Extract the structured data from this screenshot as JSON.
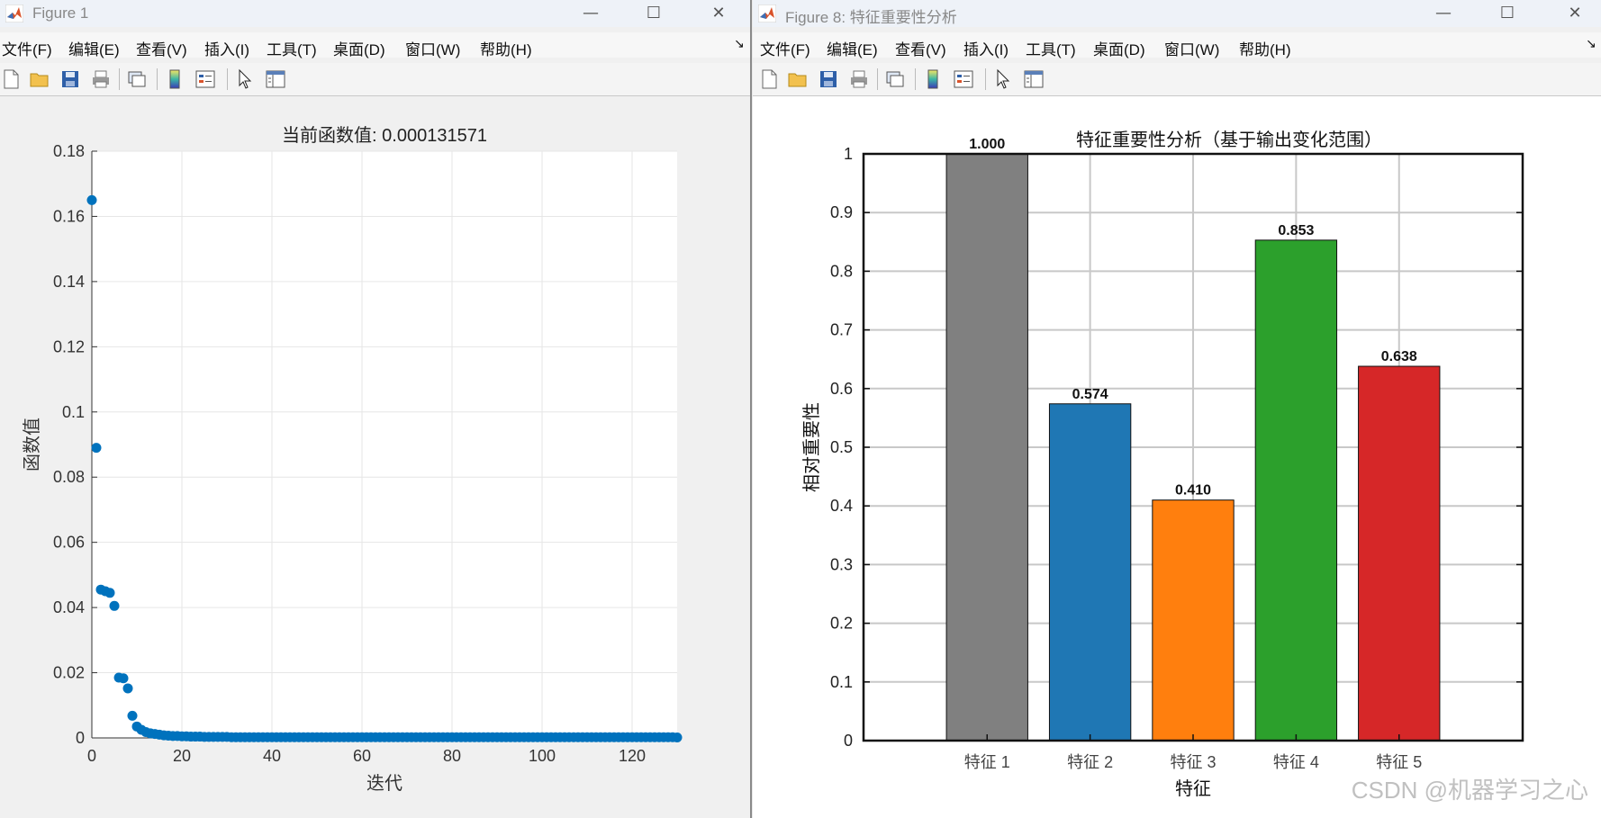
{
  "window1": {
    "title": "Figure 1",
    "controls": {
      "minimize": "—",
      "maximize": "☐",
      "close": "✕"
    },
    "menu": [
      "文件(F)",
      "编辑(E)",
      "查看(V)",
      "插入(I)",
      "工具(T)",
      "桌面(D)",
      "窗口(W)",
      "帮助(H)"
    ],
    "menu_overflow": "↘",
    "toolbar": [
      "new-file-icon",
      "open-folder-icon",
      "save-icon",
      "print-icon",
      "link-icon",
      "colorbar-icon",
      "legend-icon",
      "pointer-icon",
      "property-inspector-icon"
    ],
    "chart_data": {
      "type": "scatter",
      "title": "当前函数值: 0.000131571",
      "xlabel": "迭代",
      "ylabel": "函数值",
      "xlim": [
        0,
        130
      ],
      "ylim": [
        0,
        0.18
      ],
      "xticks": [
        "0",
        "20",
        "40",
        "60",
        "80",
        "100",
        "120"
      ],
      "yticks": [
        "0",
        "0.02",
        "0.04",
        "0.06",
        "0.08",
        "0.1",
        "0.12",
        "0.14",
        "0.16",
        "0.18"
      ],
      "grid": true,
      "point_color": "#0072bd",
      "x": [
        0,
        1,
        2,
        3,
        4,
        5,
        6,
        7,
        8,
        9,
        10,
        11,
        12,
        13,
        14,
        15,
        16,
        17,
        18,
        19,
        20,
        21,
        22,
        23,
        24,
        25,
        26,
        27,
        28,
        29,
        30,
        31,
        32,
        33,
        34,
        35,
        36,
        37,
        38,
        39,
        40,
        41,
        42,
        43,
        44,
        45,
        46,
        47,
        48,
        49,
        50,
        51,
        52,
        53,
        54,
        55,
        56,
        57,
        58,
        59,
        60,
        61,
        62,
        63,
        64,
        65,
        66,
        67,
        68,
        69,
        70,
        71,
        72,
        73,
        74,
        75,
        76,
        77,
        78,
        79,
        80,
        81,
        82,
        83,
        84,
        85,
        86,
        87,
        88,
        89,
        90,
        91,
        92,
        93,
        94,
        95,
        96,
        97,
        98,
        99,
        100,
        101,
        102,
        103,
        104,
        105,
        106,
        107,
        108,
        109,
        110,
        111,
        112,
        113,
        114,
        115,
        116,
        117,
        118,
        119,
        120,
        121,
        122,
        123,
        124,
        125,
        126,
        127,
        128,
        129,
        130
      ],
      "y": [
        0.165,
        0.089,
        0.0455,
        0.045,
        0.0445,
        0.0405,
        0.0185,
        0.0183,
        0.0152,
        0.0068,
        0.0035,
        0.0025,
        0.0018,
        0.0014,
        0.0012,
        0.001,
        0.0008,
        0.0007,
        0.0006,
        0.0006,
        0.0005,
        0.0005,
        0.0004,
        0.0004,
        0.0004,
        0.0003,
        0.0003,
        0.0003,
        0.0003,
        0.0003,
        0.0003,
        0.0002,
        0.0002,
        0.0002,
        0.0002,
        0.0002,
        0.0002,
        0.0002,
        0.0002,
        0.0002,
        0.0002,
        0.0002,
        0.0002,
        0.0002,
        0.0002,
        0.0002,
        0.0002,
        0.0002,
        0.0002,
        0.0002,
        0.0002,
        0.0002,
        0.0002,
        0.0002,
        0.0002,
        0.0002,
        0.0002,
        0.0002,
        0.0002,
        0.0002,
        0.0002,
        0.0002,
        0.0002,
        0.0002,
        0.0002,
        0.0002,
        0.0002,
        0.0002,
        0.0002,
        0.0002,
        0.0002,
        0.0002,
        0.0002,
        0.0002,
        0.0002,
        0.0002,
        0.0002,
        0.0002,
        0.0002,
        0.0002,
        0.0002,
        0.0002,
        0.0002,
        0.0002,
        0.0002,
        0.0002,
        0.0002,
        0.0002,
        0.0002,
        0.0002,
        0.0002,
        0.0002,
        0.0002,
        0.0002,
        0.0002,
        0.0002,
        0.0002,
        0.0002,
        0.0002,
        0.0002,
        0.0002,
        0.0002,
        0.0002,
        0.0002,
        0.0002,
        0.0002,
        0.0002,
        0.0002,
        0.0002,
        0.0002,
        0.0002,
        0.0002,
        0.0002,
        0.0002,
        0.0002,
        0.0002,
        0.0002,
        0.0002,
        0.0002,
        0.0002,
        0.0002,
        0.0002,
        0.0002,
        0.0002,
        0.0002,
        0.0002,
        0.0002,
        0.0002,
        0.0002,
        0.0002,
        0.00013
      ]
    }
  },
  "window2": {
    "title": "Figure 8: 特征重要性分析",
    "controls": {
      "minimize": "—",
      "maximize": "☐",
      "close": "✕"
    },
    "menu": [
      "文件(F)",
      "编辑(E)",
      "查看(V)",
      "插入(I)",
      "工具(T)",
      "桌面(D)",
      "窗口(W)",
      "帮助(H)"
    ],
    "menu_overflow": "↘",
    "toolbar": [
      "new-file-icon",
      "open-folder-icon",
      "save-icon",
      "print-icon",
      "link-icon",
      "colorbar-icon",
      "legend-icon",
      "pointer-icon",
      "property-inspector-icon"
    ],
    "chart_data": {
      "type": "bar",
      "title": "特征重要性分析（基于输出变化范围）",
      "xlabel": "特征",
      "ylabel": "相对重要性",
      "categories": [
        "特征 1",
        "特征 2",
        "特征 3",
        "特征 4",
        "特征 5"
      ],
      "values": [
        1.0,
        0.574,
        0.41,
        0.853,
        0.638
      ],
      "value_labels": [
        "1.000",
        "0.574",
        "0.410",
        "0.853",
        "0.638"
      ],
      "colors": [
        "#808080",
        "#1f77b4",
        "#ff7f0e",
        "#2ca02c",
        "#d62728"
      ],
      "ylim": [
        0,
        1
      ],
      "yticks": [
        "0",
        "0.1",
        "0.2",
        "0.3",
        "0.4",
        "0.5",
        "0.6",
        "0.7",
        "0.8",
        "0.9",
        "1"
      ],
      "grid": true
    }
  },
  "watermark": "CSDN @机器学习之心"
}
